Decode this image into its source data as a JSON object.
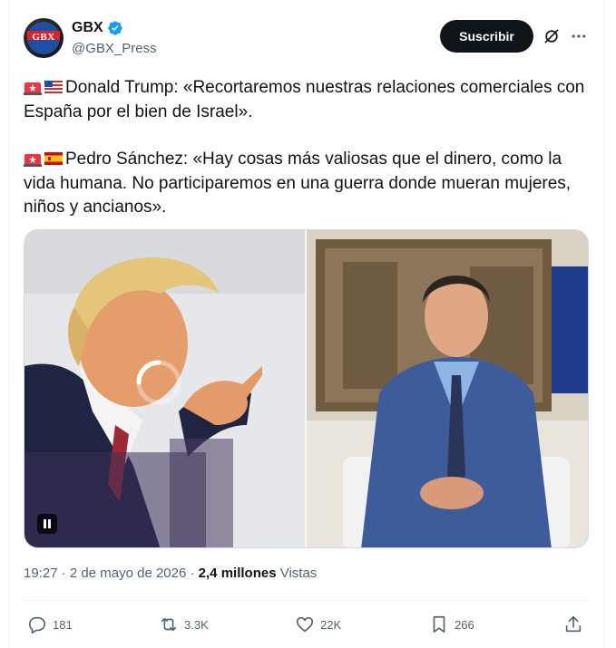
{
  "account": {
    "name": "GBX",
    "handle": "@GBX_Press",
    "avatar_text": "GBX"
  },
  "actions_top": {
    "subscribe_label": "Suscribir",
    "grok_icon": "grok-icon",
    "more_icon": "more-icon"
  },
  "tweet": {
    "paragraph_1": "Donald Trump: «Recortaremos nuestras relaciones comerciales con España por el bien de Israel».",
    "paragraph_2": "Pedro Sánchez: «Hay cosas más valiosas que el dinero, como la vida humana. No participaremos en una guerra donde mueran mujeres, niños y ancianos».",
    "emojis_1": [
      "siren-emoji",
      "us-flag-emoji"
    ],
    "emojis_2": [
      "siren-emoji",
      "spain-flag-emoji"
    ]
  },
  "media": {
    "left_photo": "photo-donald-trump",
    "right_photo": "photo-pedro-sanchez",
    "video_control": "pause-icon"
  },
  "meta": {
    "time": "19:27",
    "separator": "·",
    "date": "2 de mayo de 2026",
    "separator_2": "·",
    "views_count": "2,4 millones",
    "views_label": "Vistas"
  },
  "engagement": {
    "replies": "181",
    "reposts": "3.3K",
    "likes": "22K",
    "bookmarks": "266"
  },
  "colors": {
    "text": "#0f1419",
    "secondary": "#536471",
    "verified": "#1d9bf0",
    "button_bg": "#0f1419",
    "border": "#cfd9de"
  }
}
